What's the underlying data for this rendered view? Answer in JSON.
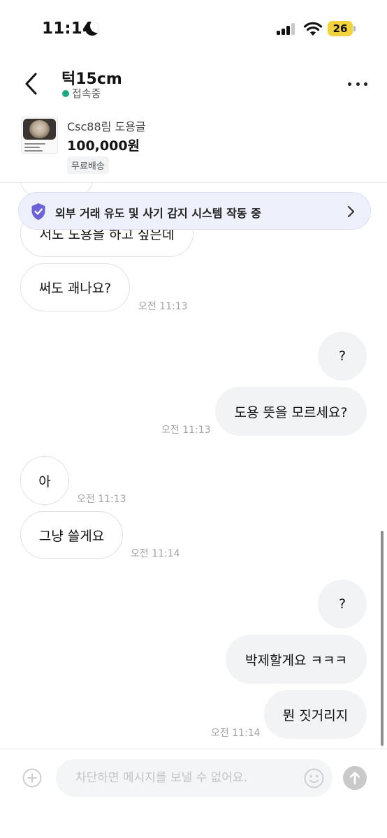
{
  "status_bar": {
    "time": "11:14",
    "battery": "26"
  },
  "header": {
    "title": "턱15cm",
    "status": "접속중"
  },
  "product": {
    "name": "Csc88림 도용글",
    "price": "100,000원",
    "shipping": "무료배송"
  },
  "safety_banner": {
    "text": "외부 거래 유도 및 사기 감지 시스템 작동 중"
  },
  "messages": [
    {
      "side": "in",
      "text": "서도 도용을 하고 싶은데"
    },
    {
      "side": "in",
      "text": "써도 괘나요?",
      "time": "오전 11:13"
    },
    {
      "side": "out",
      "text": "?"
    },
    {
      "side": "out",
      "text": "도용 뜻을 모르세요?",
      "time": "오전 11:13"
    },
    {
      "side": "in",
      "text": "아",
      "time": "오전 11:13"
    },
    {
      "side": "in",
      "text": "그냥 쓸게요",
      "time": "오전 11:14"
    },
    {
      "side": "out",
      "text": "?"
    },
    {
      "side": "out",
      "text": "박제할게요 ㅋㅋㅋ"
    },
    {
      "side": "out",
      "text": "뭔 짓거리지",
      "time": "오전 11:14"
    }
  ],
  "input": {
    "placeholder": "차단하면 메시지를 보낼 수 없어요."
  },
  "colors": {
    "online": "#1aa985",
    "banner_bg": "#eef0fb",
    "shield": "#6c63d9",
    "outgoing_bubble": "#f2f3f5"
  }
}
